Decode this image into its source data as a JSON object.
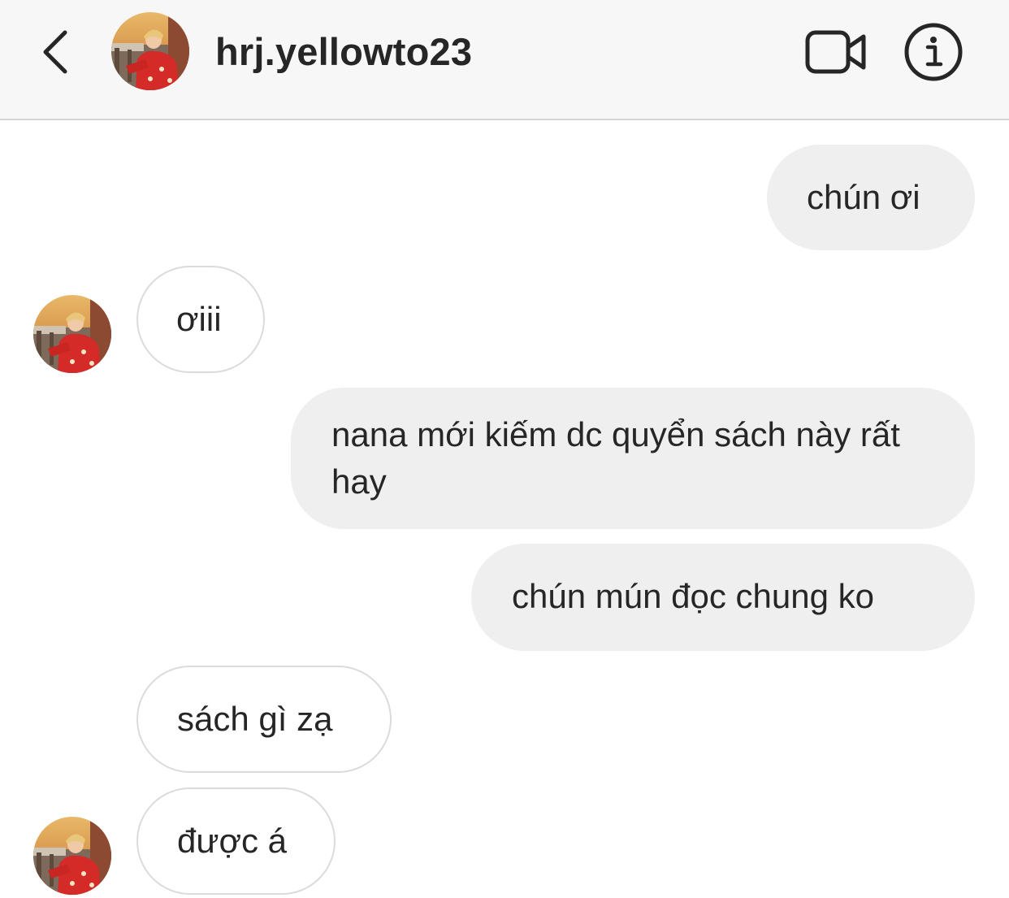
{
  "header": {
    "username": "hrj.yellowto23",
    "back_icon": "chevron-left-icon",
    "video_icon": "video-camera-icon",
    "info_icon": "info-icon"
  },
  "messages": [
    {
      "direction": "outgoing",
      "text": "chún ơi"
    },
    {
      "direction": "incoming",
      "text": "ơiii"
    },
    {
      "direction": "outgoing",
      "text": "nana mới kiếm dc quyển sách này rất hay"
    },
    {
      "direction": "outgoing",
      "text": "chún mún đọc chung ko"
    },
    {
      "direction": "incoming",
      "text": "sách gì zạ"
    },
    {
      "direction": "incoming",
      "text": "được á"
    }
  ],
  "colors": {
    "header_bg": "#f7f7f7",
    "outgoing_bubble": "#efefef",
    "incoming_border": "#dbdbdb",
    "text": "#262626"
  }
}
